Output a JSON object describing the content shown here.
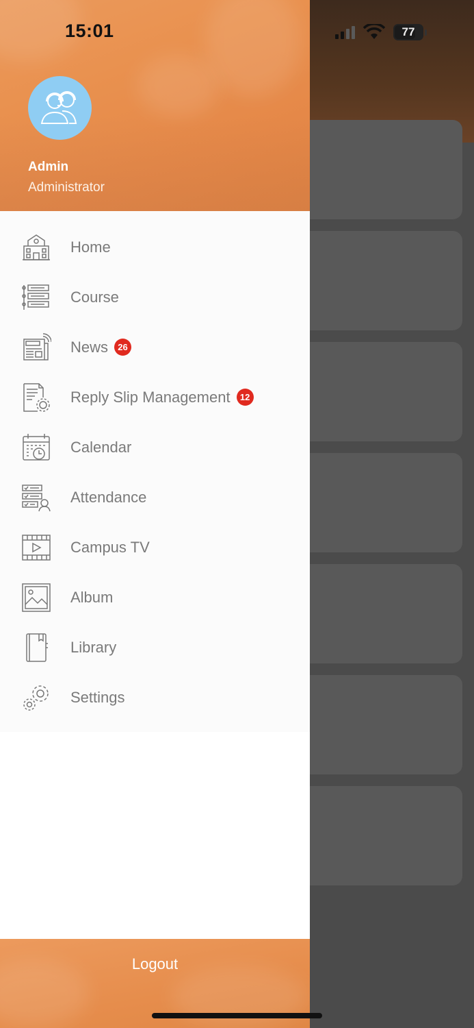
{
  "status_bar": {
    "time": "15:01",
    "battery": "77"
  },
  "user": {
    "name": "Admin",
    "role": "Administrator",
    "avatar_icon": "users-headset-icon",
    "avatar_color": "#8fcdf3"
  },
  "menu": {
    "items": [
      {
        "label": "Home",
        "icon": "school-building-icon"
      },
      {
        "label": "Course",
        "icon": "course-list-icon"
      },
      {
        "label": "News",
        "icon": "newspaper-icon",
        "badge": "26"
      },
      {
        "label": "Reply Slip Management",
        "icon": "document-gear-icon",
        "badge": "12"
      },
      {
        "label": "Calendar",
        "icon": "calendar-clock-icon"
      },
      {
        "label": "Attendance",
        "icon": "attendance-list-icon"
      },
      {
        "label": "Campus TV",
        "icon": "video-play-icon"
      },
      {
        "label": "Album",
        "icon": "image-icon"
      },
      {
        "label": "Library",
        "icon": "book-icon"
      },
      {
        "label": "Settings",
        "icon": "gears-icon"
      }
    ]
  },
  "logout_label": "Logout",
  "colors": {
    "accent": "#e8904f",
    "badge": "#e02a1f",
    "menu_text": "#7a7a7a",
    "overlay": "#4b4b4b"
  }
}
